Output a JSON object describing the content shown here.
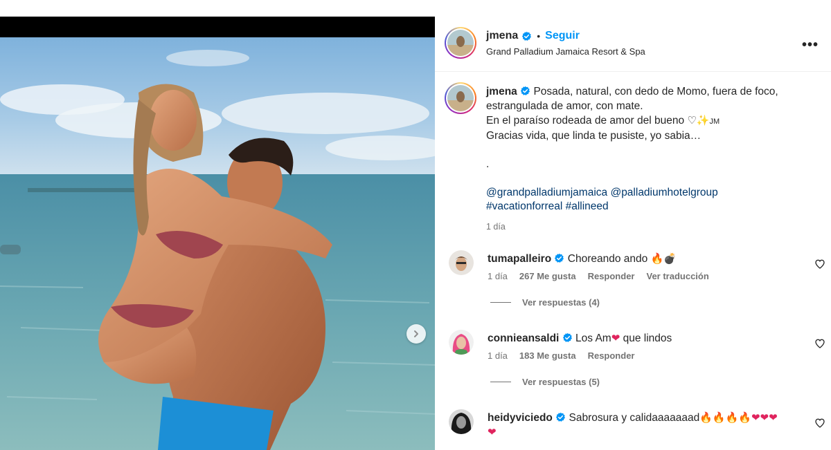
{
  "post": {
    "username": "jmena",
    "follow_label": "Seguir",
    "dot": "•",
    "location": "Grand Palladium Jamaica Resort & Spa",
    "more_label": "•••"
  },
  "caption": {
    "username": "jmena",
    "line1": "Posada, natural, con dedo de Momo, fuera de foco,",
    "line2": "estrangulada de amor, con mate.",
    "line3": "En el paraíso rodeada de amor del bueno",
    "line3_emoji": "♡✨",
    "line3_tag": "JM",
    "line4": "Gracias vida, que linda te pusiste, yo sabia…",
    "line5": ".",
    "mention1": "@grandpalladiumjamaica",
    "mention2": "@palladiumhotelgroup",
    "tag1": "#vacationforreal",
    "tag2": "#allineed",
    "time": "1 día"
  },
  "comments": [
    {
      "username": "tumapalleiro",
      "text": "Choreando ando",
      "emoji": "🔥💣",
      "time": "1 día",
      "likes": "267 Me gusta",
      "reply": "Responder",
      "translate": "Ver traducción",
      "view_replies": "Ver respuestas (4)"
    },
    {
      "username": "connieansaldi",
      "text_before": "Los Am",
      "emoji_mid": "❤",
      "text_after": " que lindos",
      "time": "1 día",
      "likes": "183 Me gusta",
      "reply": "Responder",
      "view_replies": "Ver respuestas (5)"
    },
    {
      "username": "heidyviciedo",
      "text": "Sabrosura y calidaaaaaaad",
      "emoji_fire": "🔥🔥🔥🔥",
      "emoji_hearts": "❤❤❤",
      "emoji_line2": "❤"
    }
  ],
  "icons": {
    "verified": "verified-badge-icon",
    "heart": "heart-outline-icon",
    "next": "chevron-right-icon",
    "more": "more-options-icon"
  },
  "colors": {
    "link": "#00376b",
    "accent": "#0095f6",
    "verified": "#0095f6",
    "muted": "#737373"
  }
}
